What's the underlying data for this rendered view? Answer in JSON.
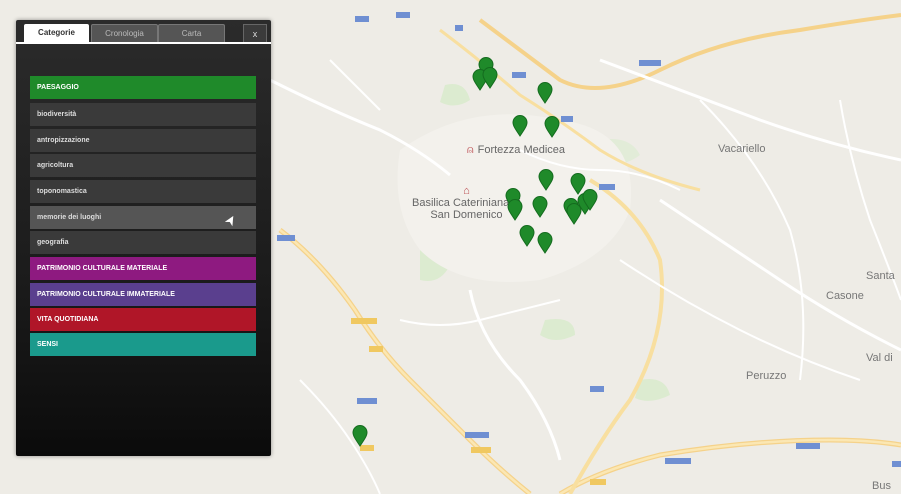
{
  "panel": {
    "tabs": [
      "Categorie",
      "Cronologia",
      "Carta"
    ],
    "close_label": "x",
    "categories": [
      {
        "label": "PAESAGGIO",
        "color": "#1f8a2a",
        "type": "main"
      },
      {
        "label": "biodiversità",
        "type": "sub"
      },
      {
        "label": "antropizzazione",
        "type": "sub"
      },
      {
        "label": "agricoltura",
        "type": "sub"
      },
      {
        "label": "toponomastica",
        "type": "sub"
      },
      {
        "label": "memorie dei luoghi",
        "type": "sub",
        "hover": true
      },
      {
        "label": "geografia",
        "type": "sub"
      },
      {
        "label": "PATRIMONIO CULTURALE MATERIALE",
        "color": "#8e1a80",
        "type": "main"
      },
      {
        "label": "PATRIMONIO CULTURALE IMMATERIALE",
        "color": "#5a3f8e",
        "type": "main"
      },
      {
        "label": "VITA QUOTIDIANA",
        "color": "#b01628",
        "type": "main"
      },
      {
        "label": "SENSI",
        "color": "#1a9a8c",
        "type": "main"
      }
    ]
  },
  "map": {
    "places": [
      "Fortezza Medicea",
      "Basilica Cateriniana di",
      "San Domenico",
      "Vacariello",
      "Santa",
      "Casone",
      "Val di",
      "Peruzzo",
      "Bus"
    ],
    "marker_color": "#1f8a2a",
    "marker_count": 22
  }
}
